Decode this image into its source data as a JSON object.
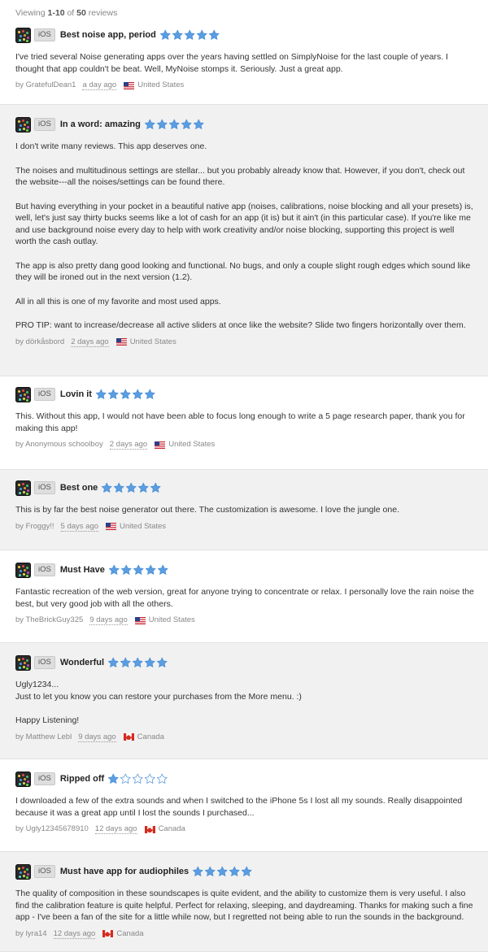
{
  "header": {
    "prefix": "Viewing",
    "range": "1-10",
    "of": "of",
    "total": "50",
    "suffix": "reviews"
  },
  "colors": {
    "star_fill": "#5a9de0",
    "star_empty": "#ffffff",
    "star_stroke": "#4a8fd6"
  },
  "reviews": [
    {
      "platform": "iOS",
      "title": "Best noise app, period",
      "rating": 5,
      "paragraphs": [
        "I've tried several Noise generating apps over the years having settled on SimplyNoise for the last couple of years. I thought that app couldn't be beat. Well, MyNoise stomps it. Seriously. Just a great app."
      ],
      "author": "by GratefulDean1",
      "date": "a day ago",
      "country": "United States",
      "flag": "us"
    },
    {
      "platform": "iOS",
      "title": "In a word: amazing",
      "rating": 5,
      "paragraphs": [
        "I don't write many reviews. This app deserves one.",
        "The noises and multitudinous settings are stellar... but you probably already know that. However, if you don't, check out the website---all the noises/settings can be found there.",
        "But having everything in your pocket in a beautiful native app (noises, calibrations, noise blocking and all your presets) is, well, let's just say thirty bucks seems like a lot of cash for an app (it is) but it ain't (in this particular case). If you're like me and use background noise every day to help with work creativity and/or noise blocking, supporting this project is well worth the cash outlay.",
        "The app is also pretty dang good looking and functional. No bugs, and only a couple slight rough edges which sound like they will be ironed out in the next version (1.2).",
        "All in all this is one of my favorite and most used apps.",
        "PRO TIP: want to increase/decrease all active sliders at once like the website? Slide two fingers horizontally over them."
      ],
      "author": "by dörkåsbord",
      "date": "2 days ago",
      "country": "United States",
      "flag": "us"
    },
    {
      "platform": "iOS",
      "title": "Lovin it",
      "rating": 5,
      "paragraphs": [
        "This. Without this app, I would not have been able to focus long enough to write a 5 page research paper, thank you for making this app!"
      ],
      "author": "by Anonymous schoolboy",
      "date": "2 days ago",
      "country": "United States",
      "flag": "us"
    },
    {
      "platform": "iOS",
      "title": "Best one",
      "rating": 5,
      "paragraphs": [
        "This is by far the best noise generator out there. The customization is awesome. I love the jungle one."
      ],
      "author": "by Froggy!!",
      "date": "5 days ago",
      "country": "United States",
      "flag": "us"
    },
    {
      "platform": "iOS",
      "title": "Must Have",
      "rating": 5,
      "paragraphs": [
        "Fantastic recreation of the web version, great for anyone trying to concentrate or relax. I personally love the rain noise the best, but very good job with all the others."
      ],
      "author": "by TheBrickGuy325",
      "date": "9 days ago",
      "country": "United States",
      "flag": "us"
    },
    {
      "platform": "iOS",
      "title": "Wonderful",
      "rating": 5,
      "paragraphs": [
        "Ugly1234...\nJust to let you know you can restore your purchases from the More menu. :)",
        "Happy Listening!"
      ],
      "author": "by Matthew Lebl",
      "date": "9 days ago",
      "country": "Canada",
      "flag": "ca"
    },
    {
      "platform": "iOS",
      "title": "Ripped off",
      "rating": 1,
      "paragraphs": [
        "I downloaded a few of the extra sounds and when I switched to the iPhone 5s I lost all my sounds. Really disappointed because it was a great app until I lost the sounds I purchased..."
      ],
      "author": "by Ugly12345678910",
      "date": "12 days ago",
      "country": "Canada",
      "flag": "ca"
    },
    {
      "platform": "iOS",
      "title": "Must have app for audiophiles",
      "rating": 5,
      "paragraphs": [
        "The quality of composition in these soundscapes is quite evident, and the ability to customize them is very useful. I also find the calibration feature is quite helpful. Perfect for relaxing, sleeping, and daydreaming. Thanks for making such a fine app - I've been a fan of the site for a little while now, but I regretted not being able to run the sounds in the background."
      ],
      "author": "by lyra14",
      "date": "12 days ago",
      "country": "Canada",
      "flag": "ca"
    }
  ]
}
